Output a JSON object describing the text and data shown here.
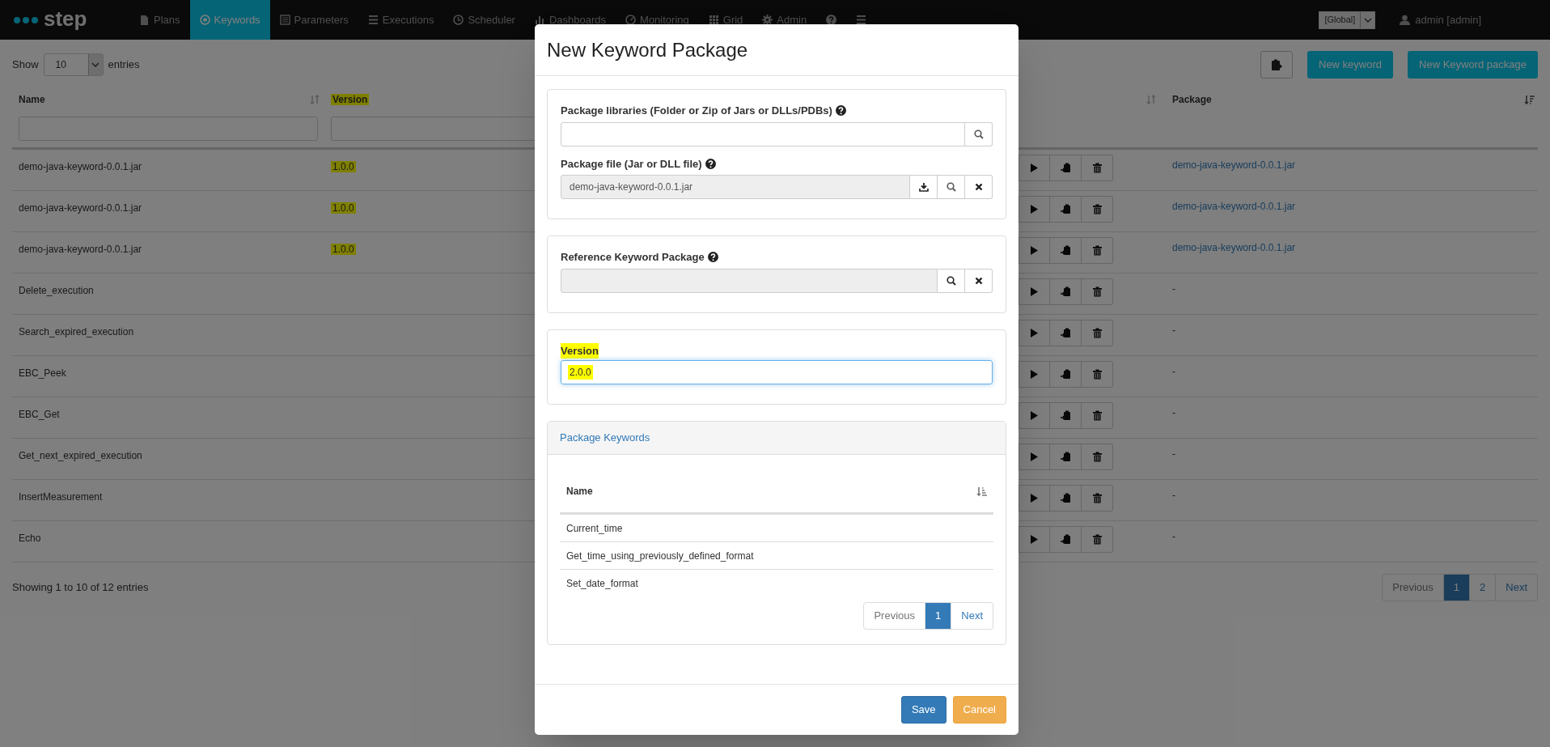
{
  "navbar": {
    "brand": "step",
    "items": [
      {
        "label": "Plans",
        "selected": false
      },
      {
        "label": "Keywords",
        "selected": true
      },
      {
        "label": "Parameters",
        "selected": false
      },
      {
        "label": "Executions",
        "selected": false
      },
      {
        "label": "Scheduler",
        "selected": false
      },
      {
        "label": "Dashboards",
        "selected": false
      },
      {
        "label": "Monitoring",
        "selected": false
      },
      {
        "label": "Grid",
        "selected": false
      },
      {
        "label": "Admin",
        "selected": false
      },
      {
        "selected": false
      },
      {
        "selected": false
      }
    ],
    "scope_select": "[Global]",
    "user": "admin [admin]"
  },
  "keywords_table": {
    "show_label": "Show",
    "page_size": "10",
    "entries_label": "entries",
    "toolbar_buttons": [
      "New keyword",
      "New Keyword package"
    ],
    "columns": [
      {
        "label": "Name",
        "highlighted": false
      },
      {
        "label": "Version",
        "highlighted": true
      },
      {
        "label": "Package",
        "highlighted": false
      }
    ],
    "rows": [
      {
        "name": "demo-java-keyword-0.0.1.jar",
        "version": "1.0.0",
        "version_highlighted": true,
        "package": "demo-java-keyword-0.0.1.jar",
        "package_link": true
      },
      {
        "name": "demo-java-keyword-0.0.1.jar",
        "version": "1.0.0",
        "version_highlighted": true,
        "package": "demo-java-keyword-0.0.1.jar",
        "package_link": true
      },
      {
        "name": "demo-java-keyword-0.0.1.jar",
        "version": "1.0.0",
        "version_highlighted": true,
        "package": "demo-java-keyword-0.0.1.jar",
        "package_link": true
      },
      {
        "name": "Delete_execution",
        "package": "-",
        "package_link": false
      },
      {
        "name": "Search_expired_execution",
        "package": "-",
        "package_link": false
      },
      {
        "name": "EBC_Peek",
        "package": "-",
        "package_link": false
      },
      {
        "name": "EBC_Get",
        "package": "-",
        "package_link": false
      },
      {
        "name": "Get_next_expired_execution",
        "package": "-",
        "package_link": false
      },
      {
        "name": "InsertMeasurement",
        "package": "-",
        "package_link": false
      },
      {
        "name": "Echo",
        "package": "-",
        "package_link": false
      }
    ],
    "info": "Showing 1 to 10 of 12 entries",
    "pagination": [
      {
        "label": "Previous",
        "selected": false
      },
      {
        "label": "1",
        "selected": true
      },
      {
        "label": "2",
        "selected": false
      },
      {
        "label": "Next",
        "selected": false
      }
    ]
  },
  "modal": {
    "title": "New Keyword Package",
    "libraries": {
      "label": "Package libraries (Folder or Zip of Jars or DLLs/PDBs)"
    },
    "package_file": {
      "label": "Package file (Jar or DLL file)",
      "value": "demo-java-keyword-0.0.1.jar"
    },
    "reference_package": {
      "label": "Reference Keyword Package"
    },
    "version": {
      "label": "Version",
      "value": "2.0.0",
      "highlighted": true
    },
    "package_keywords": {
      "title": "Package Keywords",
      "column": "Name",
      "rows": [
        "Current_time",
        "Get_time_using_previously_defined_format",
        "Set_date_format"
      ],
      "pagination": [
        {
          "label": "Previous",
          "selected": false
        },
        {
          "label": "1",
          "selected": true
        },
        {
          "label": "Next",
          "selected": false
        }
      ]
    },
    "buttons": [
      {
        "label": "Save",
        "kind": "primary"
      },
      {
        "label": "Cancel",
        "kind": "warning"
      }
    ]
  }
}
